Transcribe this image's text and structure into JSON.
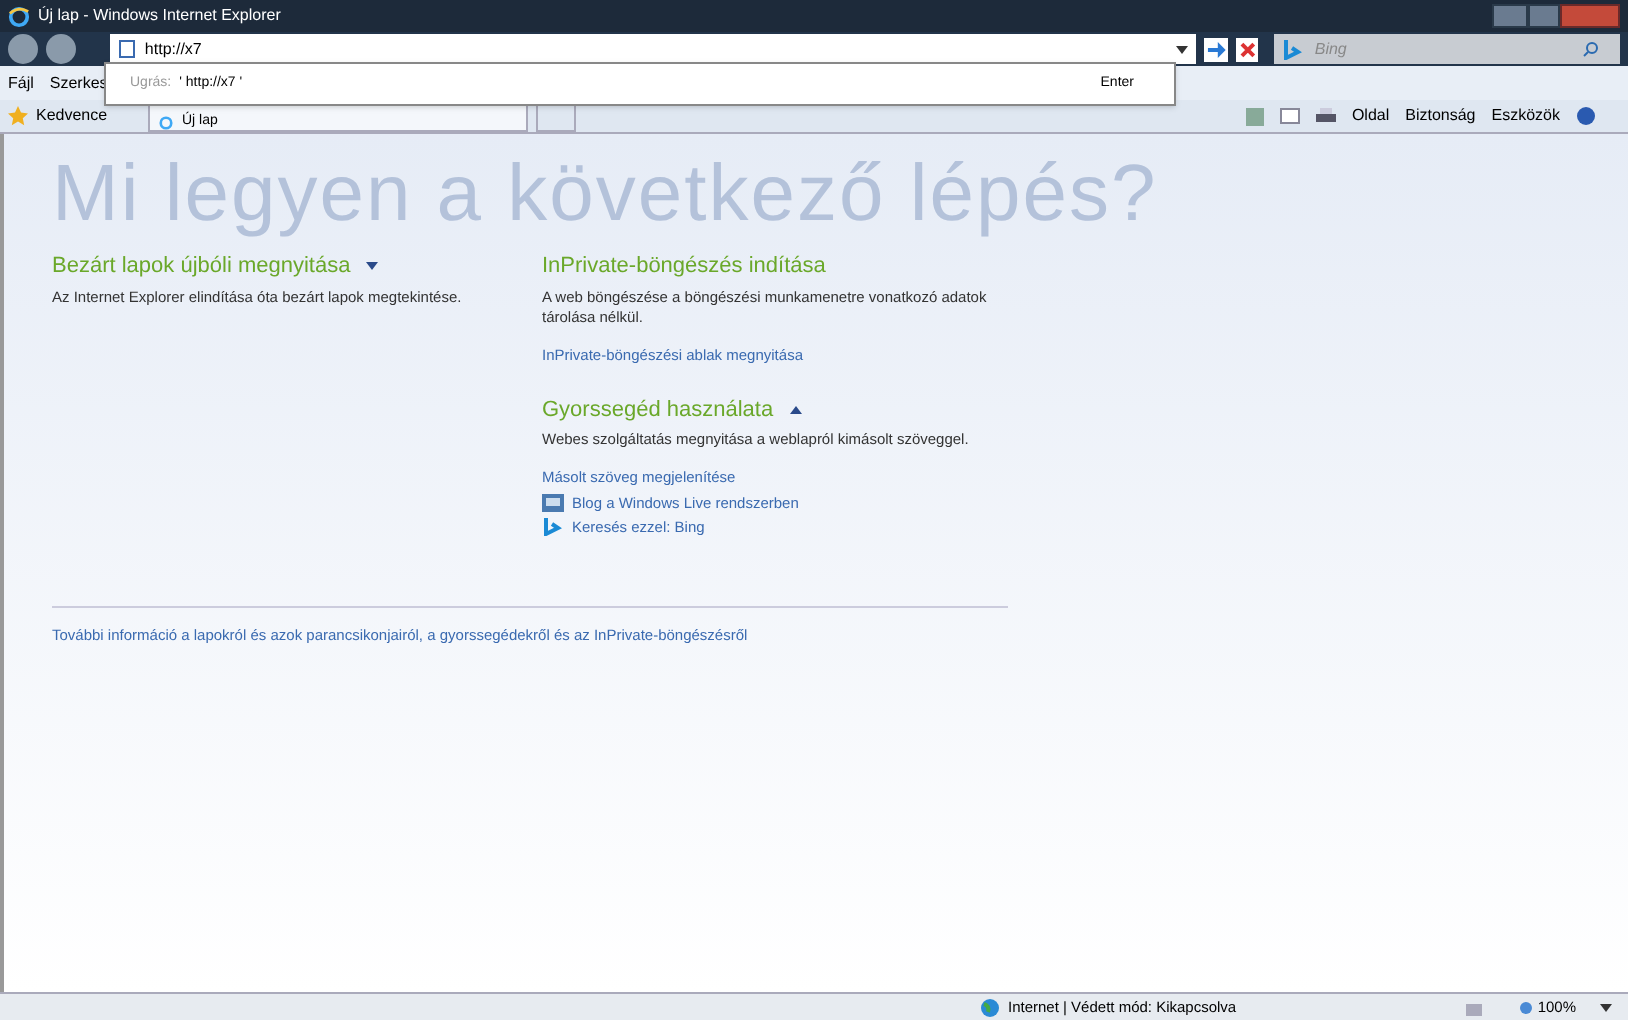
{
  "window": {
    "title": "Új lap - Windows Internet Explorer"
  },
  "address_bar": {
    "value": "http://x7"
  },
  "address_dropdown": {
    "label": "Ugrás:",
    "url": "' http://x7 '",
    "action": "Enter"
  },
  "search": {
    "placeholder": "Bing"
  },
  "menu": [
    "Fájl",
    "Szerkes"
  ],
  "favorites": {
    "label": "Kedvence",
    "tab": "Új lap"
  },
  "command_bar": [
    "Oldal",
    "Biztonság",
    "Eszközök"
  ],
  "heading": "Mi legyen a következő lépés?",
  "left_sections": [
    {
      "title": "Bezárt lapok újbóli megnyitása",
      "expanded": false,
      "text": "Az Internet Explorer elindítása óta bezárt lapok megtekintése."
    }
  ],
  "right_sections": [
    {
      "title": "InPrivate-böngészés indítása",
      "text": "A web böngészése a böngészési munkamenetre vonatkozó adatok tárolása nélkül.",
      "links": [
        {
          "label": "InPrivate-böngészési ablak megnyitása",
          "kind": "plain"
        }
      ]
    },
    {
      "title": "Gyorssegéd használata",
      "expanded": true,
      "text": "Webes szolgáltatás megnyitása a weblapról kimásolt szöveggel.",
      "links": [
        {
          "label": "Másolt szöveg megjelenítése",
          "kind": "plain"
        },
        {
          "label": "Blog a Windows Live rendszerben",
          "kind": "blog"
        },
        {
          "label": "Keresés ezzel: Bing",
          "kind": "bing"
        }
      ]
    }
  ],
  "footer_link": "További információ a lapokról és azok parancsikonjairól, a gyorssegédekről és az InPrivate-böngészésről",
  "status_bar": {
    "zone": "Internet | Védett mód: Kikapcsolva",
    "zoom": "100%"
  }
}
